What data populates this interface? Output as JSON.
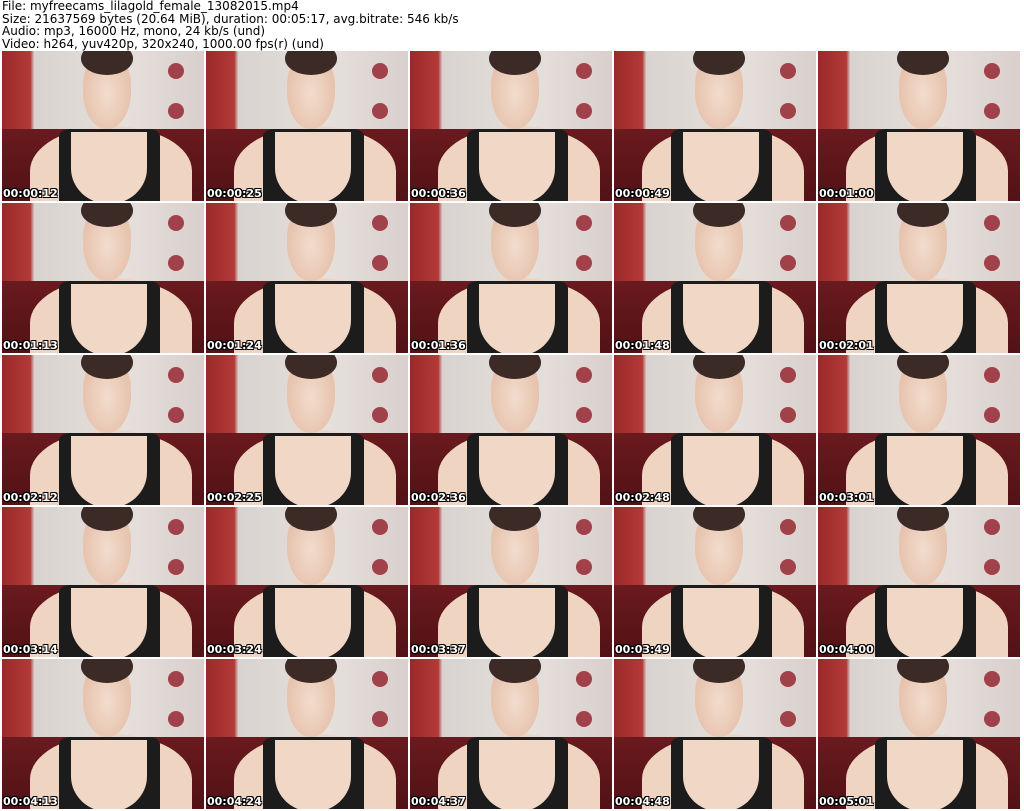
{
  "header": {
    "file": "File: myfreecams_lilagold_female_13082015.mp4",
    "size": "Size: 21637569 bytes (20.64 MiB), duration: 00:05:17, avg.bitrate: 546 kb/s",
    "audio": "Audio: mp3, 16000 Hz, mono, 24 kb/s (und)",
    "video": "Video: h264, yuv420p, 320x240, 1000.00 fps(r) (und)"
  },
  "thumbnails": [
    "00:00:12",
    "00:00:25",
    "00:00:36",
    "00:00:49",
    "00:01:00",
    "00:01:13",
    "00:01:24",
    "00:01:36",
    "00:01:48",
    "00:02:01",
    "00:02:12",
    "00:02:25",
    "00:02:36",
    "00:02:48",
    "00:03:01",
    "00:03:14",
    "00:03:24",
    "00:03:37",
    "00:03:49",
    "00:04:00",
    "00:04:13",
    "00:04:24",
    "00:04:37",
    "00:04:48",
    "00:05:01"
  ]
}
